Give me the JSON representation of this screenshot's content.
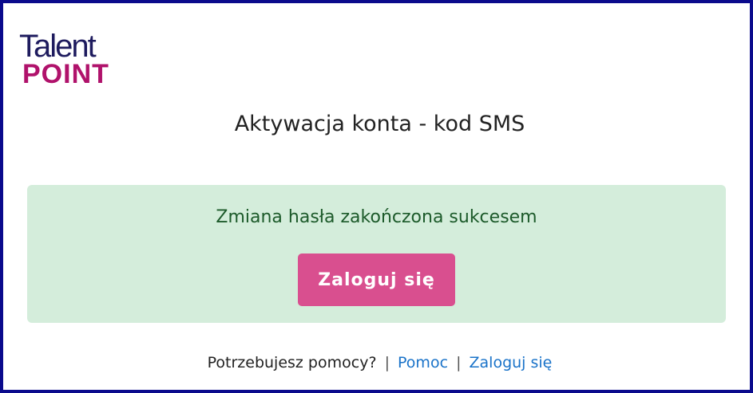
{
  "logo": {
    "line1": "Talent",
    "line2": "POINT"
  },
  "page": {
    "title": "Aktywacja konta - kod SMS"
  },
  "alert": {
    "message": "Zmiana hasła zakończona sukcesem",
    "login_button_label": "Zaloguj się"
  },
  "footer": {
    "help_text": "Potrzebujesz pomocy?",
    "separator": "|",
    "help_link": "Pomoc",
    "login_link": "Zaloguj się"
  },
  "colors": {
    "frame_border": "#0a0a8c",
    "logo_primary": "#1e1b5e",
    "logo_accent": "#b0126b",
    "success_background": "#d4eddb",
    "success_text": "#1c5a2a",
    "button_background": "#d94f8f",
    "link": "#1a73c9"
  }
}
